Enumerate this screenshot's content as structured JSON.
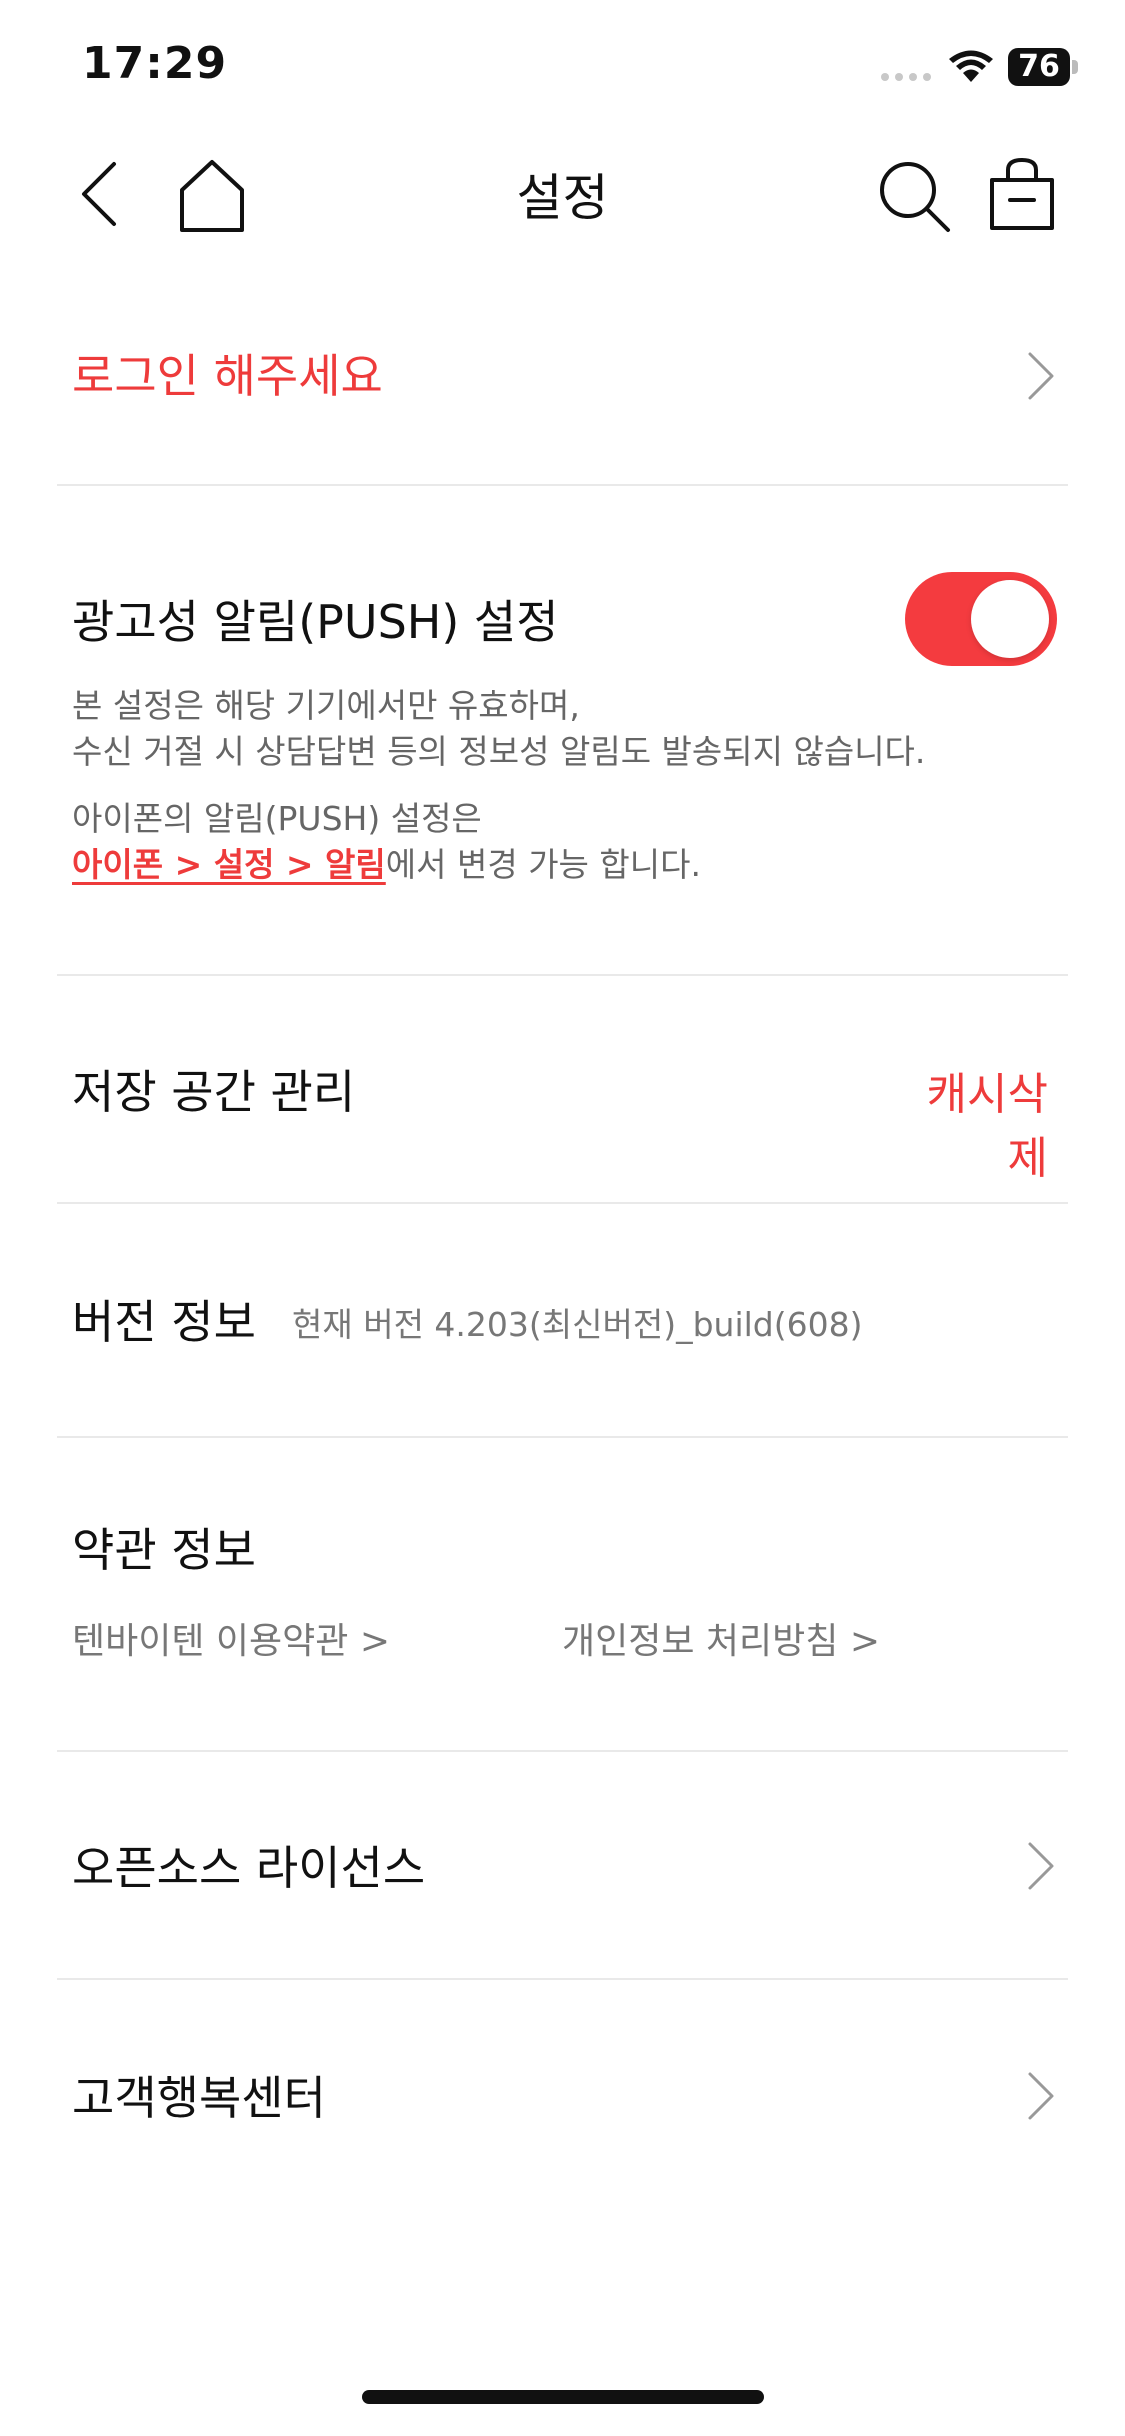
{
  "status_bar": {
    "time": "17:29",
    "battery": "76"
  },
  "header": {
    "title": "설정",
    "icons": [
      "back-icon",
      "home-icon",
      "search-icon",
      "shopping-bag-icon"
    ]
  },
  "login": {
    "label": "로그인 해주세요"
  },
  "push": {
    "title": "광고성 알림(PUSH) 설정",
    "toggle_on": true,
    "desc_line1": "본 설정은 해당 기기에서만 유효하며,",
    "desc_line2": "수신 거절 시 상담답변 등의 정보성 알림도 발송되지 않습니다.",
    "note_line1": "아이폰의 알림(PUSH) 설정은",
    "note_link": "아이폰 > 설정 > 알림",
    "note_suffix": "에서 변경 가능 합니다."
  },
  "storage": {
    "title": "저장 공간 관리",
    "action": "캐시삭제"
  },
  "version": {
    "title": "버전 정보",
    "value": "현재 버전 4.203(최신버전)_build(608)"
  },
  "terms": {
    "title": "약관 정보",
    "link1": "텐바이텐 이용약관 >",
    "link2": "개인정보 처리방침 >"
  },
  "opensource": {
    "title": "오픈소스 라이선스"
  },
  "support": {
    "title": "고객행복센터"
  },
  "colors": {
    "accent": "#ee3b3b",
    "toggle": "#f43b3f"
  }
}
